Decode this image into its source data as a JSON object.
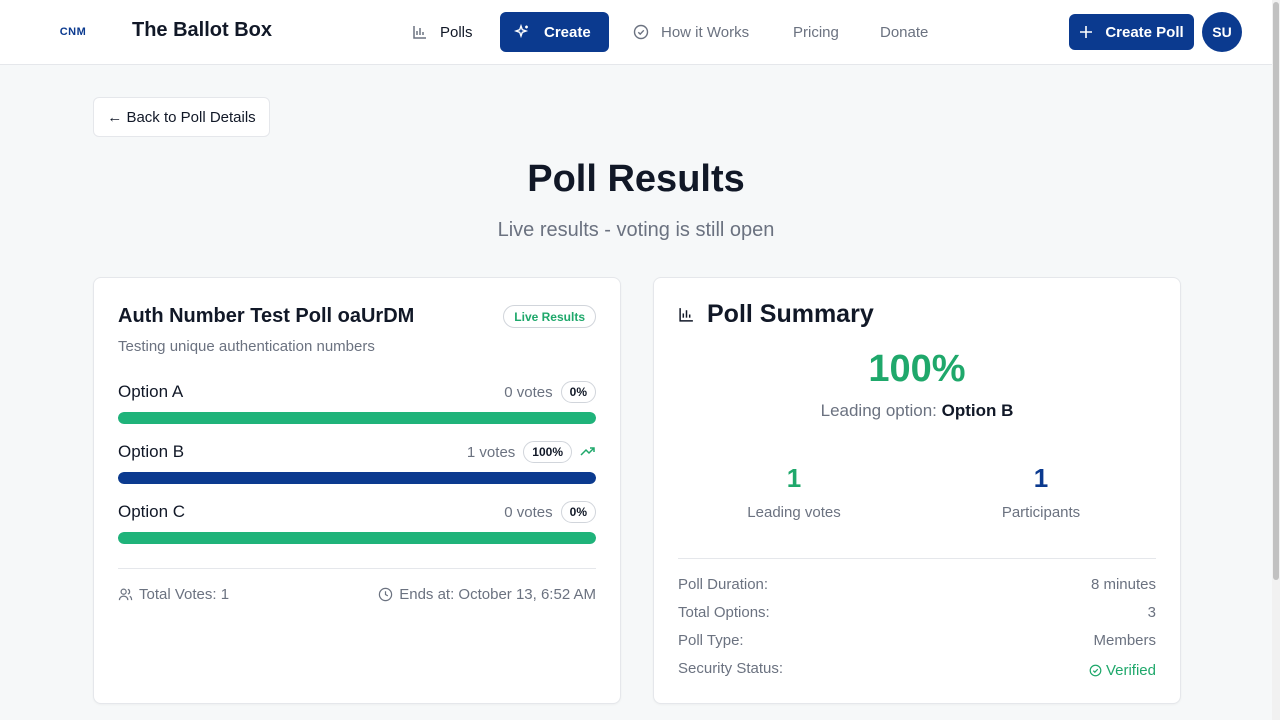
{
  "header": {
    "logo_text": "CNM",
    "brand": "The Ballot Box",
    "nav": {
      "polls": "Polls",
      "create": "Create",
      "how_it_works": "How it Works",
      "pricing": "Pricing",
      "donate": "Donate"
    },
    "create_poll": "Create Poll",
    "avatar_initials": "SU"
  },
  "back_button": "← Back to Poll Details",
  "page": {
    "title": "Poll Results",
    "subtitle": "Live results - voting is still open"
  },
  "poll_card": {
    "title": "Auth Number Test Poll oaUrDM",
    "badge": "Live Results",
    "description": "Testing unique authentication numbers",
    "options": [
      {
        "name": "Option A",
        "votes": "0 votes",
        "percent": "0%",
        "bar_fill": 1.0,
        "bar_color": "#1fb37a",
        "leading": false
      },
      {
        "name": "Option B",
        "votes": "1 votes",
        "percent": "100%",
        "bar_fill": 1.0,
        "bar_color": "#0b3a8f",
        "leading": true
      },
      {
        "name": "Option C",
        "votes": "0 votes",
        "percent": "0%",
        "bar_fill": 1.0,
        "bar_color": "#1fb37a",
        "leading": false
      }
    ],
    "total_votes": "Total Votes: 1",
    "ends_at": "Ends at: October 13, 6:52 AM"
  },
  "summary_card": {
    "title": "Poll Summary",
    "leading_percent": "100%",
    "leading_label": "Leading option:",
    "leading_option": "Option B",
    "stats": [
      {
        "value": "1",
        "label": "Leading votes",
        "color": "#1fa86b"
      },
      {
        "value": "1",
        "label": "Participants",
        "color": "#0b3a8f"
      }
    ],
    "details": [
      {
        "label": "Poll Duration:",
        "value": "8 minutes"
      },
      {
        "label": "Total Options:",
        "value": "3"
      },
      {
        "label": "Poll Type:",
        "value": "Members"
      },
      {
        "label": "Security Status:",
        "value": "Verified"
      }
    ]
  },
  "colors": {
    "primary": "#0b3a8f",
    "success": "#1fa86b"
  }
}
